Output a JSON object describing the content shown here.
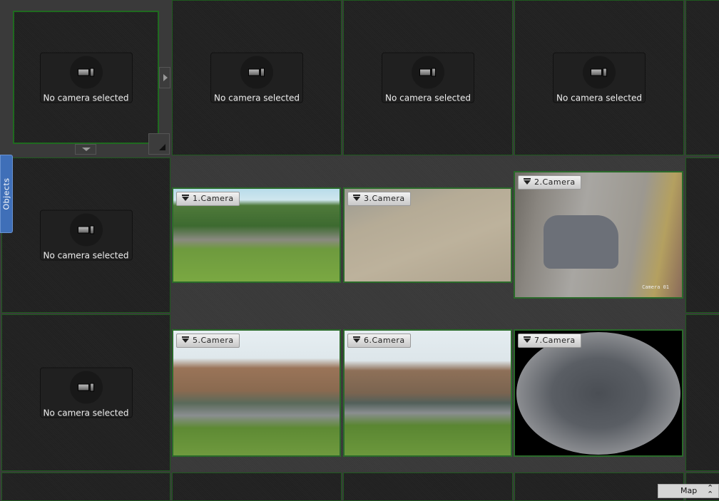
{
  "empty_cell_text": "No camera selected",
  "objects_tab": "Objects",
  "map_button": "Map",
  "cameras": [
    {
      "label": "1.Camera"
    },
    {
      "label": "3.Camera"
    },
    {
      "label": "2.Camera",
      "overlay": "Camera 01"
    },
    {
      "label": "5.Camera"
    },
    {
      "label": "6.Camera"
    },
    {
      "label": "7.Camera"
    }
  ],
  "colors": {
    "cell_border": "#1e5a1e",
    "objects_tab": "#3f6fb8"
  }
}
